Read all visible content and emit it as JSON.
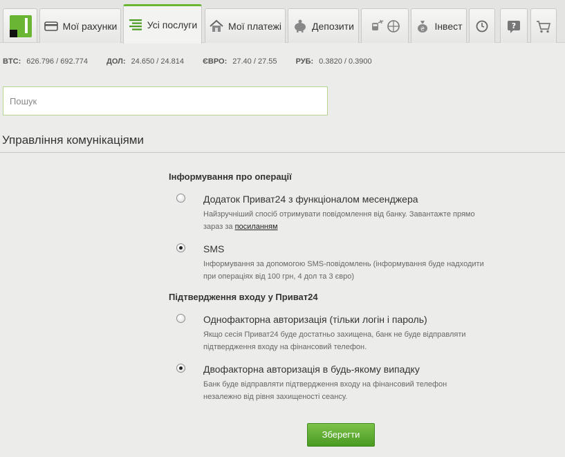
{
  "nav": {
    "logo_label": "ПриватБанк",
    "tabs": [
      {
        "name": "my-accounts",
        "label": "Мої рахунки",
        "icon": "card-icon"
      },
      {
        "name": "all-services",
        "label": "Усі послуги",
        "icon": "list-icon",
        "active": true
      },
      {
        "name": "my-payments",
        "label": "Мої платежі",
        "icon": "house-icon"
      },
      {
        "name": "deposits",
        "label": "Депозити",
        "icon": "piggy-bank-icon"
      },
      {
        "name": "travel",
        "label": "",
        "icon": "travel-icon"
      },
      {
        "name": "invest",
        "label": "Інвест",
        "icon": "money-bag-icon"
      },
      {
        "name": "history",
        "label": "",
        "icon": "history-icon"
      },
      {
        "name": "help",
        "label": "",
        "icon": "help-icon"
      },
      {
        "name": "cart",
        "label": "",
        "icon": "cart-icon"
      }
    ]
  },
  "rates": [
    {
      "code": "BTC:",
      "value": "626.796 / 692.774"
    },
    {
      "code": "ДОЛ:",
      "value": "24.650 / 24.814"
    },
    {
      "code": "ЄВРО:",
      "value": "27.40 / 27.55"
    },
    {
      "code": "РУБ:",
      "value": "0.3820 / 0.3900"
    }
  ],
  "search": {
    "placeholder": "Пошук",
    "value": ""
  },
  "section_title": "Управління комунікаціями",
  "groups": [
    {
      "title": "Інформування про операції",
      "options": [
        {
          "label": "Додаток Приват24 з функціоналом месенджера",
          "desc_line1": "Найзручніший спосіб отримувати повідомлення від банку. Завантажте прямо",
          "desc_line2_prefix": "зараз за ",
          "desc_link": "посиланням",
          "checked": false
        },
        {
          "label": "SMS",
          "desc_line1": "Інформування за допомогою SMS-повідомлень (інформування буде надходити",
          "desc_line2": "при операціях від 100 грн, 4 дол та 3 євро)",
          "checked": true
        }
      ]
    },
    {
      "title": "Підтвердження входу у Приват24",
      "options": [
        {
          "label": "Однофакторна авторизація (тільки логін і пароль)",
          "desc_line1": "Якщо сесія Приват24 буде достатньо захищена, банк не буде відправляти",
          "desc_line2": "підтвердження входу на фінансовий телефон.",
          "checked": false
        },
        {
          "label": "Двофакторна авторизація в будь-якому випадку",
          "desc_line1": "Банк буде відправляти підтвердження входу на фінансовий телефон",
          "desc_line2": "незалежно від рівня захищеності сеансу.",
          "checked": true
        }
      ]
    }
  ],
  "save_label": "Зберегти",
  "colors": {
    "accent": "#6ab534",
    "button": "#4a9a22"
  }
}
